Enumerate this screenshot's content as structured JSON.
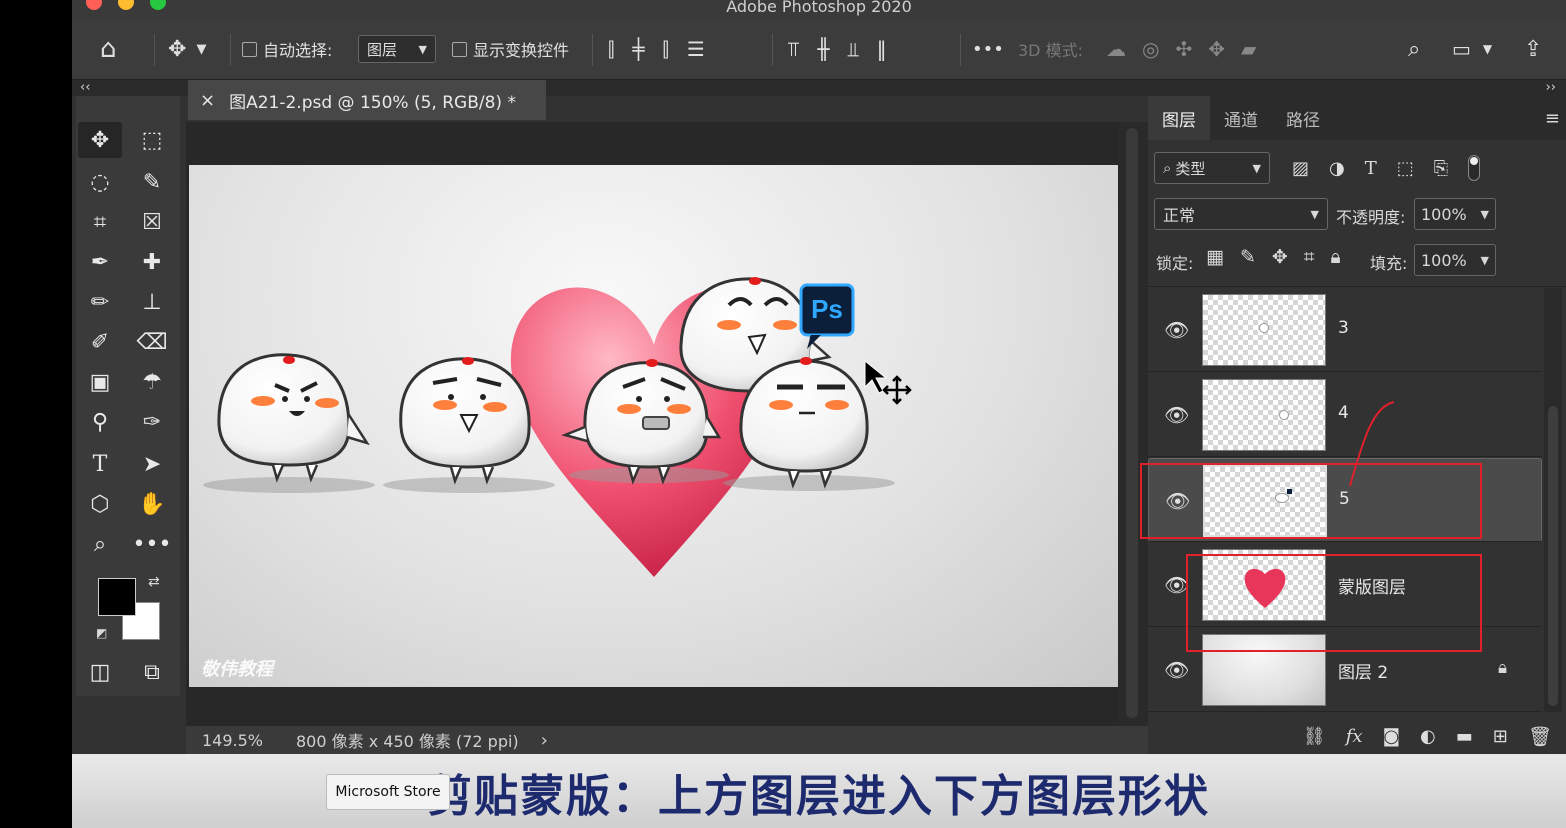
{
  "window": {
    "title": "Adobe Photoshop 2020"
  },
  "options_bar": {
    "auto_select_label": "自动选择:",
    "auto_select_target": "图层",
    "show_transform_label": "显示变换控件",
    "more_label": "•••",
    "mode_3d_label": "3D 模式:"
  },
  "collapse": {
    "left": "‹‹",
    "right": "››"
  },
  "document": {
    "tab_title": "图A21-2.psd @ 150% (5, RGB/8) *",
    "close_glyph": "×",
    "watermark": "敬伟教程",
    "ps_badge": "Ps"
  },
  "status": {
    "zoom": "149.5%",
    "dimensions": "800 像素 x 450 像素 (72 ppi)",
    "arrow": "›"
  },
  "layers_panel": {
    "tabs": [
      "图层",
      "通道",
      "路径"
    ],
    "filter_type": "类型",
    "blend_mode": "正常",
    "opacity_label": "不透明度:",
    "opacity_value": "100%",
    "lock_label": "锁定:",
    "fill_label": "填充:",
    "fill_value": "100%",
    "layers": [
      {
        "name": "3",
        "selected": false,
        "locked": false
      },
      {
        "name": "4",
        "selected": false,
        "locked": false
      },
      {
        "name": "5",
        "selected": true,
        "locked": false
      },
      {
        "name": "蒙版图层",
        "selected": false,
        "locked": false
      },
      {
        "name": "图层 2",
        "selected": false,
        "locked": true
      }
    ],
    "bottom_fx": "fx"
  },
  "caption": {
    "text": "剪贴蒙版：上方图层进入下方图层形状",
    "tooltip": "Microsoft Store"
  },
  "colors": {
    "accent_red": "#e0202a",
    "caption_text": "#1e2a6e",
    "ps_blue": "#31a8ff"
  }
}
